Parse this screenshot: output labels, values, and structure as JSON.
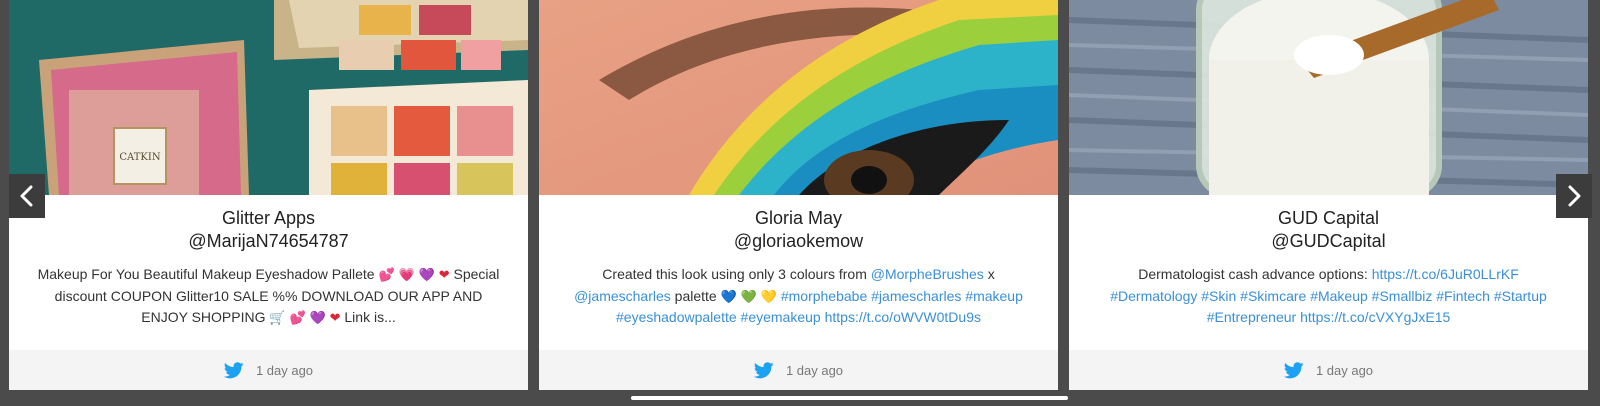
{
  "nav": {
    "prev_icon": "chevron-left-icon",
    "next_icon": "chevron-right-icon"
  },
  "colors": {
    "link": "#3a8fd8",
    "twitter": "#1da1f2",
    "footer_bg": "#f4f4f4",
    "background": "#4b4b4b"
  },
  "cards": [
    {
      "image": "makeup-palette-photo",
      "author": "Glitter Apps",
      "handle": "@MarijaN74654787",
      "text": {
        "part1": "Makeup For You Beautiful Makeup Eyeshadow Pallete ",
        "emoji1": "💕",
        "emoji2": "💗",
        "emoji3": "💜",
        "emoji4": "❤",
        "part2": " Special discount COUPON Glitter10 SALE %% DOWNLOAD OUR APP AND ENJOY SHOPPING ",
        "emoji5": "🛒",
        "emoji6": "💕",
        "emoji7": "💜",
        "emoji8": "❤",
        "part3": " Link is..."
      },
      "time": "1 day ago"
    },
    {
      "image": "eye-makeup-photo",
      "author": "Gloria May",
      "handle": "@gloriaokemow",
      "text": {
        "part1": "Created this look using only 3 colours from ",
        "mention1": "@MorpheBrushes",
        "part2": " x ",
        "mention2": "@jamescharles",
        "part3": " palette ",
        "emoji1": "💙",
        "emoji2": "💚",
        "emoji3": "💛",
        "hashtags": " #morphebabe #jamescharles #makeup #eyeshadowpalette #eyemakeup https://t.co/oWVW0tDu9s"
      },
      "time": "1 day ago"
    },
    {
      "image": "cream-jar-photo",
      "author": "GUD Capital",
      "handle": "@GUDCapital",
      "text": {
        "part1": "Dermatologist cash advance options: ",
        "links": "https://t.co/6JuR0LLrKF #Dermatology #Skin #Skimcare #Makeup #Smallbiz #Fintech #Startup #Entrepreneur https://t.co/cVXYgJxE15"
      },
      "time": "1 day ago"
    }
  ]
}
